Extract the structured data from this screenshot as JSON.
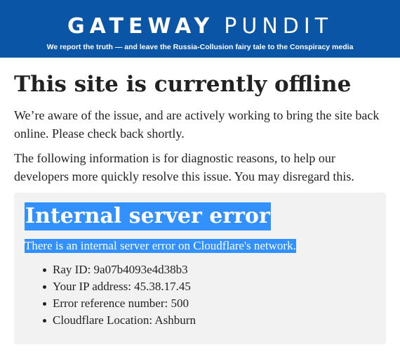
{
  "header": {
    "logo_word1": "GATEWAY",
    "logo_word2": "PUNDIT",
    "tagline": "We report the truth — and leave the Russia-Collusion fairy tale to the Conspiracy media",
    "background_color": "#0b55a6"
  },
  "main": {
    "title": "This site is currently offline",
    "paragraph1": "We’re aware of the issue, and are actively working to bring the site back online. Please check back shortly.",
    "paragraph2": "The following information is for diagnostic reasons, to help our developers more quickly resolve this issue. You may disregard this."
  },
  "error": {
    "title": "Internal server error",
    "description": "There is an internal server error on Cloudflare's network.",
    "highlight_color": "#3390ff",
    "details": [
      {
        "text": "Ray ID: 9a07b4093e4d38b3"
      },
      {
        "text": "Your IP address: 45.38.17.45"
      },
      {
        "text": "Error reference number: 500"
      },
      {
        "text": "Cloudflare Location: Ashburn"
      }
    ]
  }
}
